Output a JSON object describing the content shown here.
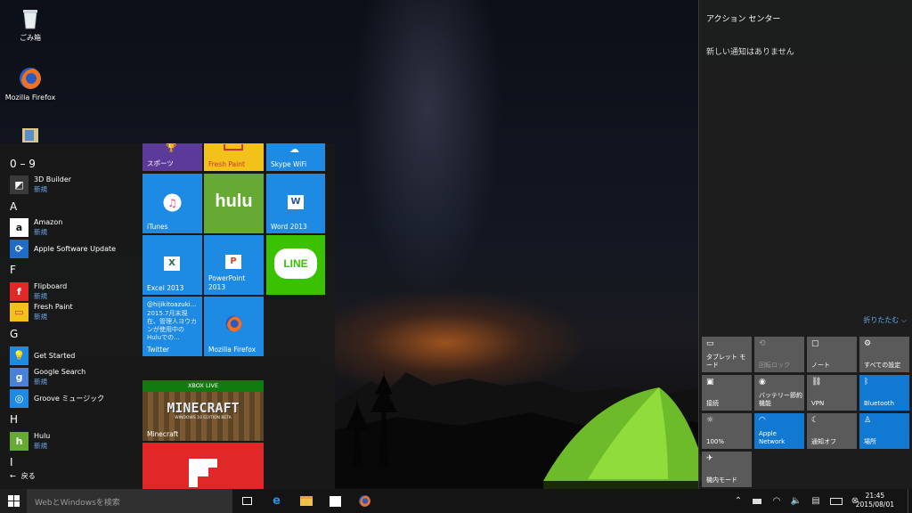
{
  "desktop": {
    "icons": [
      {
        "label": "ごみ箱",
        "icon": "recycle-bin-icon"
      },
      {
        "label": "Mozilla Firefox",
        "icon": "firefox-icon"
      }
    ]
  },
  "start_menu": {
    "groups": {
      "g0": "0 – 9",
      "gA": "A",
      "gF": "F",
      "gG": "G",
      "gH": "H",
      "gI": "I"
    },
    "apps": [
      {
        "name": "3D Builder",
        "sub": "新規"
      },
      {
        "name": "Amazon",
        "sub": "新規"
      },
      {
        "name": "Apple Software Update",
        "sub": ""
      },
      {
        "name": "Flipboard",
        "sub": "新規"
      },
      {
        "name": "Fresh Paint",
        "sub": "新規"
      },
      {
        "name": "Get Started",
        "sub": ""
      },
      {
        "name": "Google Search",
        "sub": "新規"
      },
      {
        "name": "Groove ミュージック",
        "sub": ""
      },
      {
        "name": "Hulu",
        "sub": "新規"
      }
    ],
    "back_label": "戻る",
    "tiles": {
      "sports": "スポーツ",
      "freshpaint": "Fresh Paint",
      "skype": "Skype WiFi",
      "itunes": "iTunes",
      "hulu_logo": "hulu",
      "word": "Word 2013",
      "excel": "Excel 2013",
      "powerpoint": "PowerPoint 2013",
      "line_logo": "LINE",
      "twitter_handle": "@hijikitoazuki...",
      "twitter_text": "2015.7月末現在、管理人ヨウカンが使用中のHuluでの...",
      "twitter": "Twitter",
      "firefox": "Mozilla Firefox",
      "xbox_live": "XBOX LIVE",
      "minecraft_logo": "MINECRAFT",
      "minecraft_edition": "WINDOWS 10 EDITION BETA",
      "minecraft": "Minecraft"
    }
  },
  "action_center": {
    "title": "アクション センター",
    "message": "新しい通知はありません",
    "collapse_label": "折りたたむ",
    "quick_actions": [
      {
        "label": "タブレット モード",
        "icon": "tablet-mode-icon",
        "on": false
      },
      {
        "label": "回転ロック",
        "icon": "rotation-lock-icon",
        "on": false
      },
      {
        "label": "ノート",
        "icon": "note-icon",
        "on": false
      },
      {
        "label": "すべての設定",
        "icon": "settings-icon",
        "on": false
      },
      {
        "label": "接続",
        "icon": "connect-icon",
        "on": false
      },
      {
        "label": "バッテリー節約機能",
        "icon": "battery-saver-icon",
        "on": false
      },
      {
        "label": "VPN",
        "icon": "vpn-icon",
        "on": false
      },
      {
        "label": "Bluetooth",
        "icon": "bluetooth-icon",
        "on": true
      },
      {
        "label": "100%",
        "icon": "brightness-icon",
        "on": false
      },
      {
        "label": "Apple Network",
        "icon": "wifi-icon",
        "on": true
      },
      {
        "label": "通知オフ",
        "icon": "quiet-hours-icon",
        "on": false
      },
      {
        "label": "場所",
        "icon": "location-icon",
        "on": true
      },
      {
        "label": "機内モード",
        "icon": "airplane-mode-icon",
        "on": false
      }
    ]
  },
  "taskbar": {
    "search_placeholder": "WebとWindowsを検索",
    "pinned": [
      "task-view-icon",
      "edge-icon",
      "file-explorer-icon",
      "store-icon",
      "firefox-icon"
    ],
    "clock_time": "21:45",
    "clock_date": "2015/08/01"
  },
  "colors": {
    "accent": "#1279d3",
    "start_bg": "#191919",
    "tile_blue": "#1d8ae3"
  }
}
